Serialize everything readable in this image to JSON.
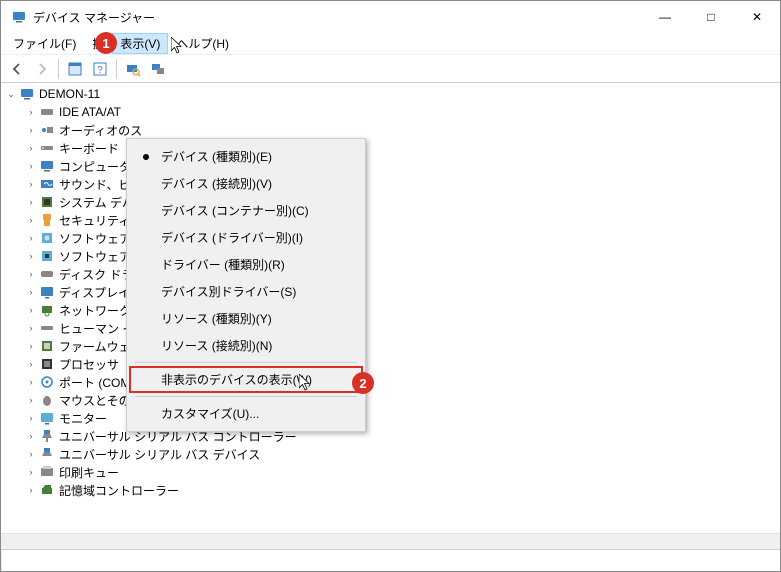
{
  "window": {
    "title": "デバイス マネージャー"
  },
  "sys": {
    "minimize": "—",
    "maximize": "□",
    "close": "✕"
  },
  "menu": {
    "file": "ファイル(F)",
    "action": "操",
    "view": "表示(V)",
    "help": "ヘルプ(H)"
  },
  "badges": {
    "b1": "1",
    "b2": "2"
  },
  "dropdown": {
    "dev_type": "デバイス (種類別)(E)",
    "dev_conn": "デバイス (接続別)(V)",
    "dev_cont": "デバイス (コンテナー別)(C)",
    "dev_drv": "デバイス (ドライバー別)(I)",
    "drv_type": "ドライバー (種類別)(R)",
    "dev_by_drv": "デバイス別ドライバー(S)",
    "res_type": "リソース (種類別)(Y)",
    "res_conn": "リソース (接続別)(N)",
    "show_hidden": "非表示のデバイスの表示(W)",
    "customize": "カスタマイズ(U)..."
  },
  "tree": {
    "root": "DEMON-11",
    "nodes": [
      "IDE ATA/AT",
      "オーディオのス",
      "キーボード",
      "コンピューター",
      "サウンド、ビテ",
      "システム デバ",
      "セキュリティ ラ",
      "ソフトウェア コ",
      "ソフトウェア ラ",
      "ディスク ドライ",
      "ディスプレイ テ",
      "ネットワーク アダプター",
      "ヒューマン インターフェイス デバイス",
      "ファームウェア",
      "プロセッサ",
      "ポート (COM と LPT)",
      "マウスとそのほかのポインティング デバイス",
      "モニター",
      "ユニバーサル シリアル バス コントローラー",
      "ユニバーサル シリアル バス デバイス",
      "印刷キュー",
      "記憶域コントローラー"
    ]
  },
  "icons": {
    "window": "computer-icon",
    "back": "arrow-left-icon",
    "forward": "arrow-right-icon",
    "props": "properties-icon",
    "help": "help-icon",
    "scan": "scan-icon",
    "devices": "devices-icon"
  }
}
